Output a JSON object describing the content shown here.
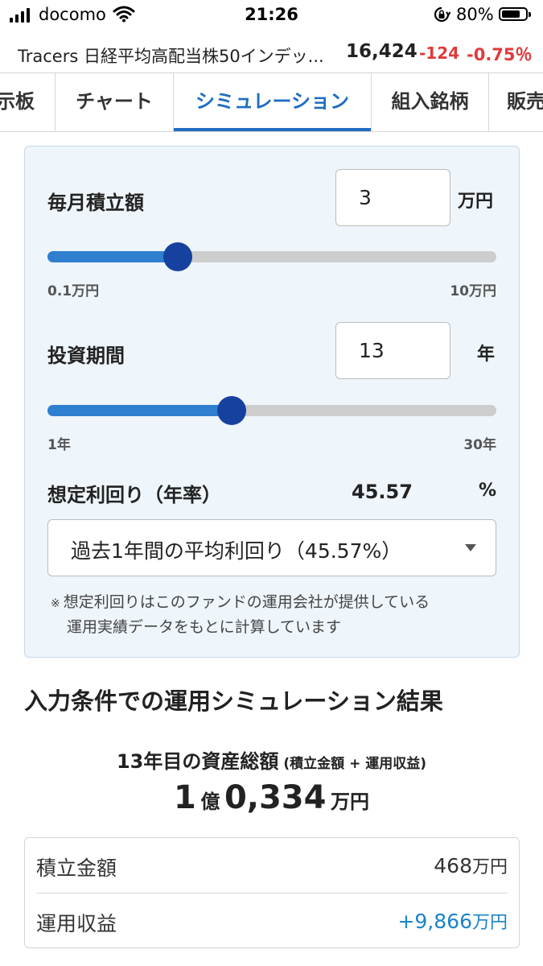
{
  "status_bar": {
    "carrier": "docomo",
    "time": "21:26",
    "battery": "80%",
    "battery_level": 0.8
  },
  "fund": {
    "name": "Tracers 日経平均高配当株50インデッ...",
    "price": "16,424",
    "change": "-124",
    "change_pct": "-0.75％"
  },
  "tabs": [
    "示板",
    "チャート",
    "シミュレーション",
    "組入銘柄",
    "販売"
  ],
  "active_tab": "シミュレーション",
  "simulation": {
    "monthly": {
      "label": "毎月積立額",
      "value": "3",
      "unit": "万円",
      "min_label": "0.1万円",
      "max_label": "10万円",
      "slider_fraction": 0.29
    },
    "period": {
      "label": "投資期間",
      "value": "13",
      "unit": "年",
      "min_label": "1年",
      "max_label": "30年",
      "slider_fraction": 0.41
    },
    "yield": {
      "label": "想定利回り（年率）",
      "value": "45.57",
      "unit": "%",
      "select_value": "過去1年間の平均利回り（45.57%）"
    },
    "note_mark": "※",
    "note_line1": "想定利回りはこのファンドの運用会社が提供している",
    "note_line2": "運用実績データをもとに計算しています"
  },
  "results": {
    "title": "入力条件での運用シミュレーション結果",
    "total_label": "13年目の資産総額",
    "total_sub": "(積立金額 + 運用収益)",
    "amount_oku": "1",
    "amount_oku_unit": "億",
    "amount_man": "0,334",
    "amount_unit": "万円",
    "rows": [
      {
        "label": "積立金額",
        "value": "468",
        "unit": "万円"
      },
      {
        "label": "運用収益",
        "value": "+9,866",
        "unit": "万円"
      }
    ],
    "accent_color": "#1a84c7"
  },
  "colors": {
    "accent": "#1f6dc1",
    "slider_fill": "#2f7fd0",
    "slider_thumb": "#16419e",
    "negative": "#e03a3a",
    "panel_bg": "#eef5fb"
  }
}
